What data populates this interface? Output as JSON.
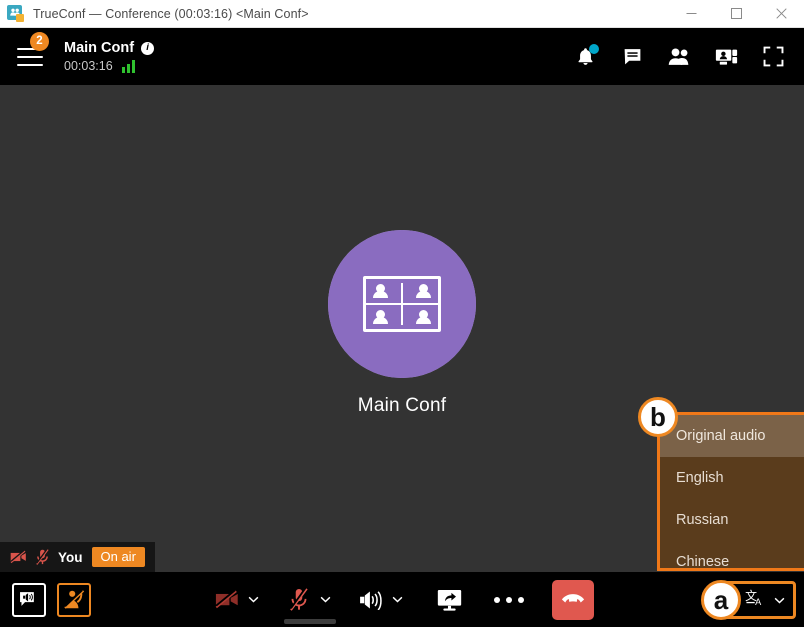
{
  "window": {
    "title": "TrueConf — Conference (00:03:16) <Main Conf>",
    "app_icon": "trueconf-app-icon",
    "minimize_label": "—",
    "maximize_label": "□",
    "close_label": "✕"
  },
  "header": {
    "menu_icon": "hamburger-menu-icon",
    "badge_count": "2",
    "conference_name": "Main Conf",
    "info_icon": "info-icon",
    "timer": "00:03:16",
    "signal_icon": "signal-strength-icon",
    "icons": [
      {
        "name": "notifications-bell-icon",
        "label": "Notifications",
        "has_dot": true
      },
      {
        "name": "chat-icon",
        "label": "Chat",
        "has_dot": false
      },
      {
        "name": "participants-icon",
        "label": "Participants",
        "has_dot": false
      },
      {
        "name": "layout-icon",
        "label": "Layout",
        "has_dot": false
      },
      {
        "name": "fullscreen-icon",
        "label": "Full screen",
        "has_dot": false
      }
    ]
  },
  "stage": {
    "avatar_icon": "conference-group-avatar",
    "participant_name": "Main Conf"
  },
  "self_view": {
    "camera_icon": "camera-off-icon",
    "mic_icon": "microphone-off-icon",
    "name": "You",
    "status_badge": "On air"
  },
  "toolbar": {
    "left": [
      {
        "name": "subtitles-button",
        "icon": "speech-bubble-sound-icon"
      },
      {
        "name": "raise-hand-button",
        "icon": "lower-hand-icon",
        "active": true
      }
    ],
    "center": [
      {
        "name": "camera-button",
        "icon": "camera-off-icon",
        "has_chevron": true
      },
      {
        "name": "microphone-button",
        "icon": "microphone-off-icon",
        "has_chevron": true
      },
      {
        "name": "speaker-button",
        "icon": "speaker-icon",
        "has_chevron": true
      },
      {
        "name": "screen-share-button",
        "icon": "screen-share-icon",
        "has_chevron": false
      },
      {
        "name": "more-options-button",
        "icon": "ellipsis-icon",
        "has_chevron": false
      },
      {
        "name": "hang-up-button",
        "icon": "phone-hangup-icon",
        "has_chevron": false
      }
    ],
    "translate_button": {
      "name": "translation-language-button",
      "icon": "translate-icon",
      "chevron": "chevron-down-icon",
      "annotation": "a"
    }
  },
  "language_menu": {
    "annotation": "b",
    "items": [
      {
        "label": "Original audio",
        "selected": true
      },
      {
        "label": "English",
        "selected": false
      },
      {
        "label": "Russian",
        "selected": false
      },
      {
        "label": "Chinese",
        "selected": false
      }
    ]
  },
  "colors": {
    "accent_orange": "#ee8822",
    "menu_border": "#f07818",
    "menu_bg": "#5a3c1c",
    "menu_hover": "#7b6248",
    "hangup_red": "#e0584f",
    "mute_red": "#e0584f",
    "signal_green": "#2fc22f",
    "notification_cyan": "#00a6c9",
    "stage_bg": "#333333",
    "avatar_purple": "#8a6cc0"
  }
}
